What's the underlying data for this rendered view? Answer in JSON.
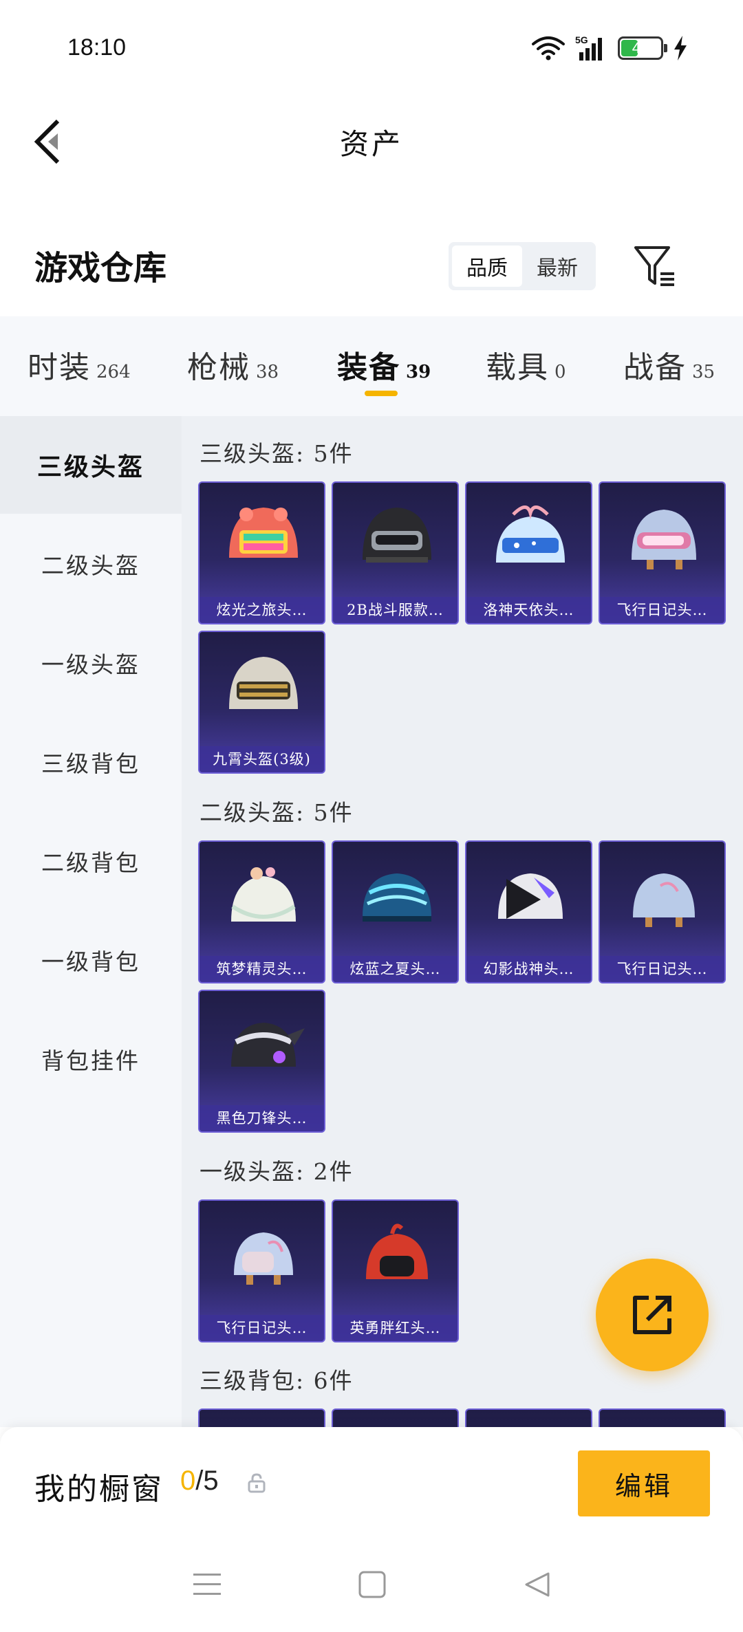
{
  "status_bar": {
    "time": "18:10",
    "battery": "40",
    "network": "5G"
  },
  "nav": {
    "title": "资产"
  },
  "warehouse": {
    "title": "游戏仓库",
    "sort_quality": "品质",
    "sort_newest": "最新"
  },
  "tabs": [
    {
      "label": "时装",
      "count": "264"
    },
    {
      "label": "枪械",
      "count": "38"
    },
    {
      "label": "装备",
      "count": "39"
    },
    {
      "label": "载具",
      "count": "0"
    },
    {
      "label": "战备",
      "count": "35"
    }
  ],
  "sidebar": {
    "items": [
      {
        "label": "三级头盔"
      },
      {
        "label": "二级头盔"
      },
      {
        "label": "一级头盔"
      },
      {
        "label": "三级背包"
      },
      {
        "label": "二级背包"
      },
      {
        "label": "一级背包"
      },
      {
        "label": "背包挂件"
      }
    ]
  },
  "sections": [
    {
      "title": "三级头盔: 5件",
      "items": [
        {
          "name": "炫光之旅头…"
        },
        {
          "name": "2B战斗服款…"
        },
        {
          "name": "洛神天依头…"
        },
        {
          "name": "飞行日记头…"
        },
        {
          "name": "九霄头盔(3级)"
        }
      ]
    },
    {
      "title": "二级头盔: 5件",
      "items": [
        {
          "name": "筑梦精灵头…"
        },
        {
          "name": "炫蓝之夏头…"
        },
        {
          "name": "幻影战神头…"
        },
        {
          "name": "飞行日记头…"
        },
        {
          "name": "黑色刀锋头…"
        }
      ]
    },
    {
      "title": "一级头盔: 2件",
      "items": [
        {
          "name": "飞行日记头…"
        },
        {
          "name": "英勇胖红头…"
        }
      ]
    },
    {
      "title": "三级背包: 6件",
      "items": []
    }
  ],
  "showcase": {
    "label": "我的橱窗",
    "current": "0",
    "total": "/5",
    "edit_label": "编辑"
  },
  "colors": {
    "accent": "#fbb41b",
    "indicator": "#f5b400",
    "card_purple": "#4a3ea6"
  }
}
